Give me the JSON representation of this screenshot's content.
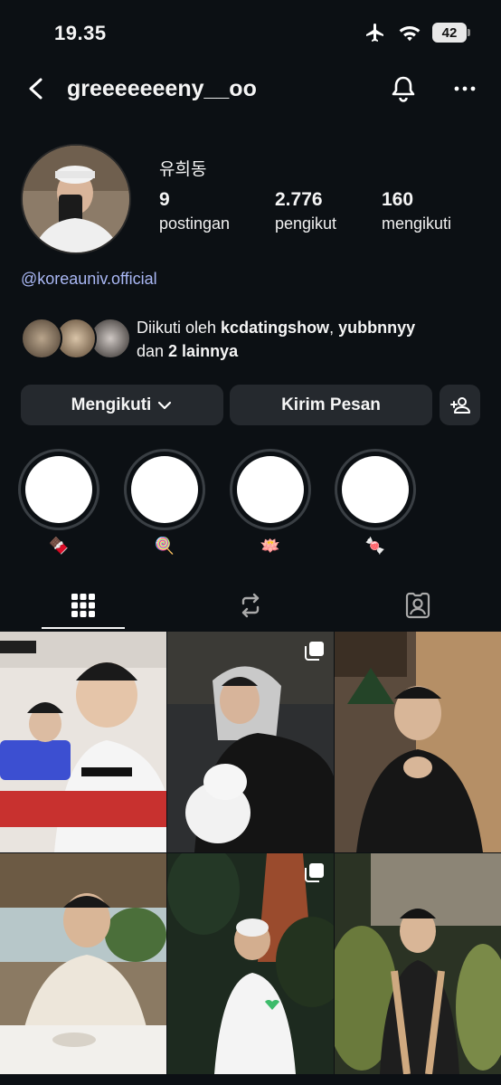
{
  "status_bar": {
    "time": "19.35",
    "battery": "42"
  },
  "header": {
    "username": "greeeeeeeny__oo"
  },
  "profile": {
    "name": "유희동",
    "stats": [
      {
        "value": "9",
        "label": "postingan"
      },
      {
        "value": "2.776",
        "label": "pengikut"
      },
      {
        "value": "160",
        "label": "mengikuti"
      }
    ],
    "link": "@koreauniv.official",
    "followed_by": {
      "prefix": "Diikuti oleh ",
      "user1": "kcdatingshow",
      "separator": ", ",
      "user2": "yubbnnyy",
      "and": "dan ",
      "others": "2 lainnya"
    }
  },
  "actions": {
    "following": "Mengikuti",
    "message": "Kirim Pesan"
  },
  "highlights": [
    {
      "emoji": "🍫"
    },
    {
      "emoji": "🍭"
    },
    {
      "emoji": "🪷"
    },
    {
      "emoji": "🍬"
    }
  ],
  "tabs": [
    {
      "icon": "grid-icon",
      "active": true
    },
    {
      "icon": "reels-icon",
      "active": false
    },
    {
      "icon": "tagged-icon",
      "active": false
    }
  ],
  "colors": {
    "background": "#0c1014",
    "button": "#25292e",
    "link": "#aab8f5"
  }
}
